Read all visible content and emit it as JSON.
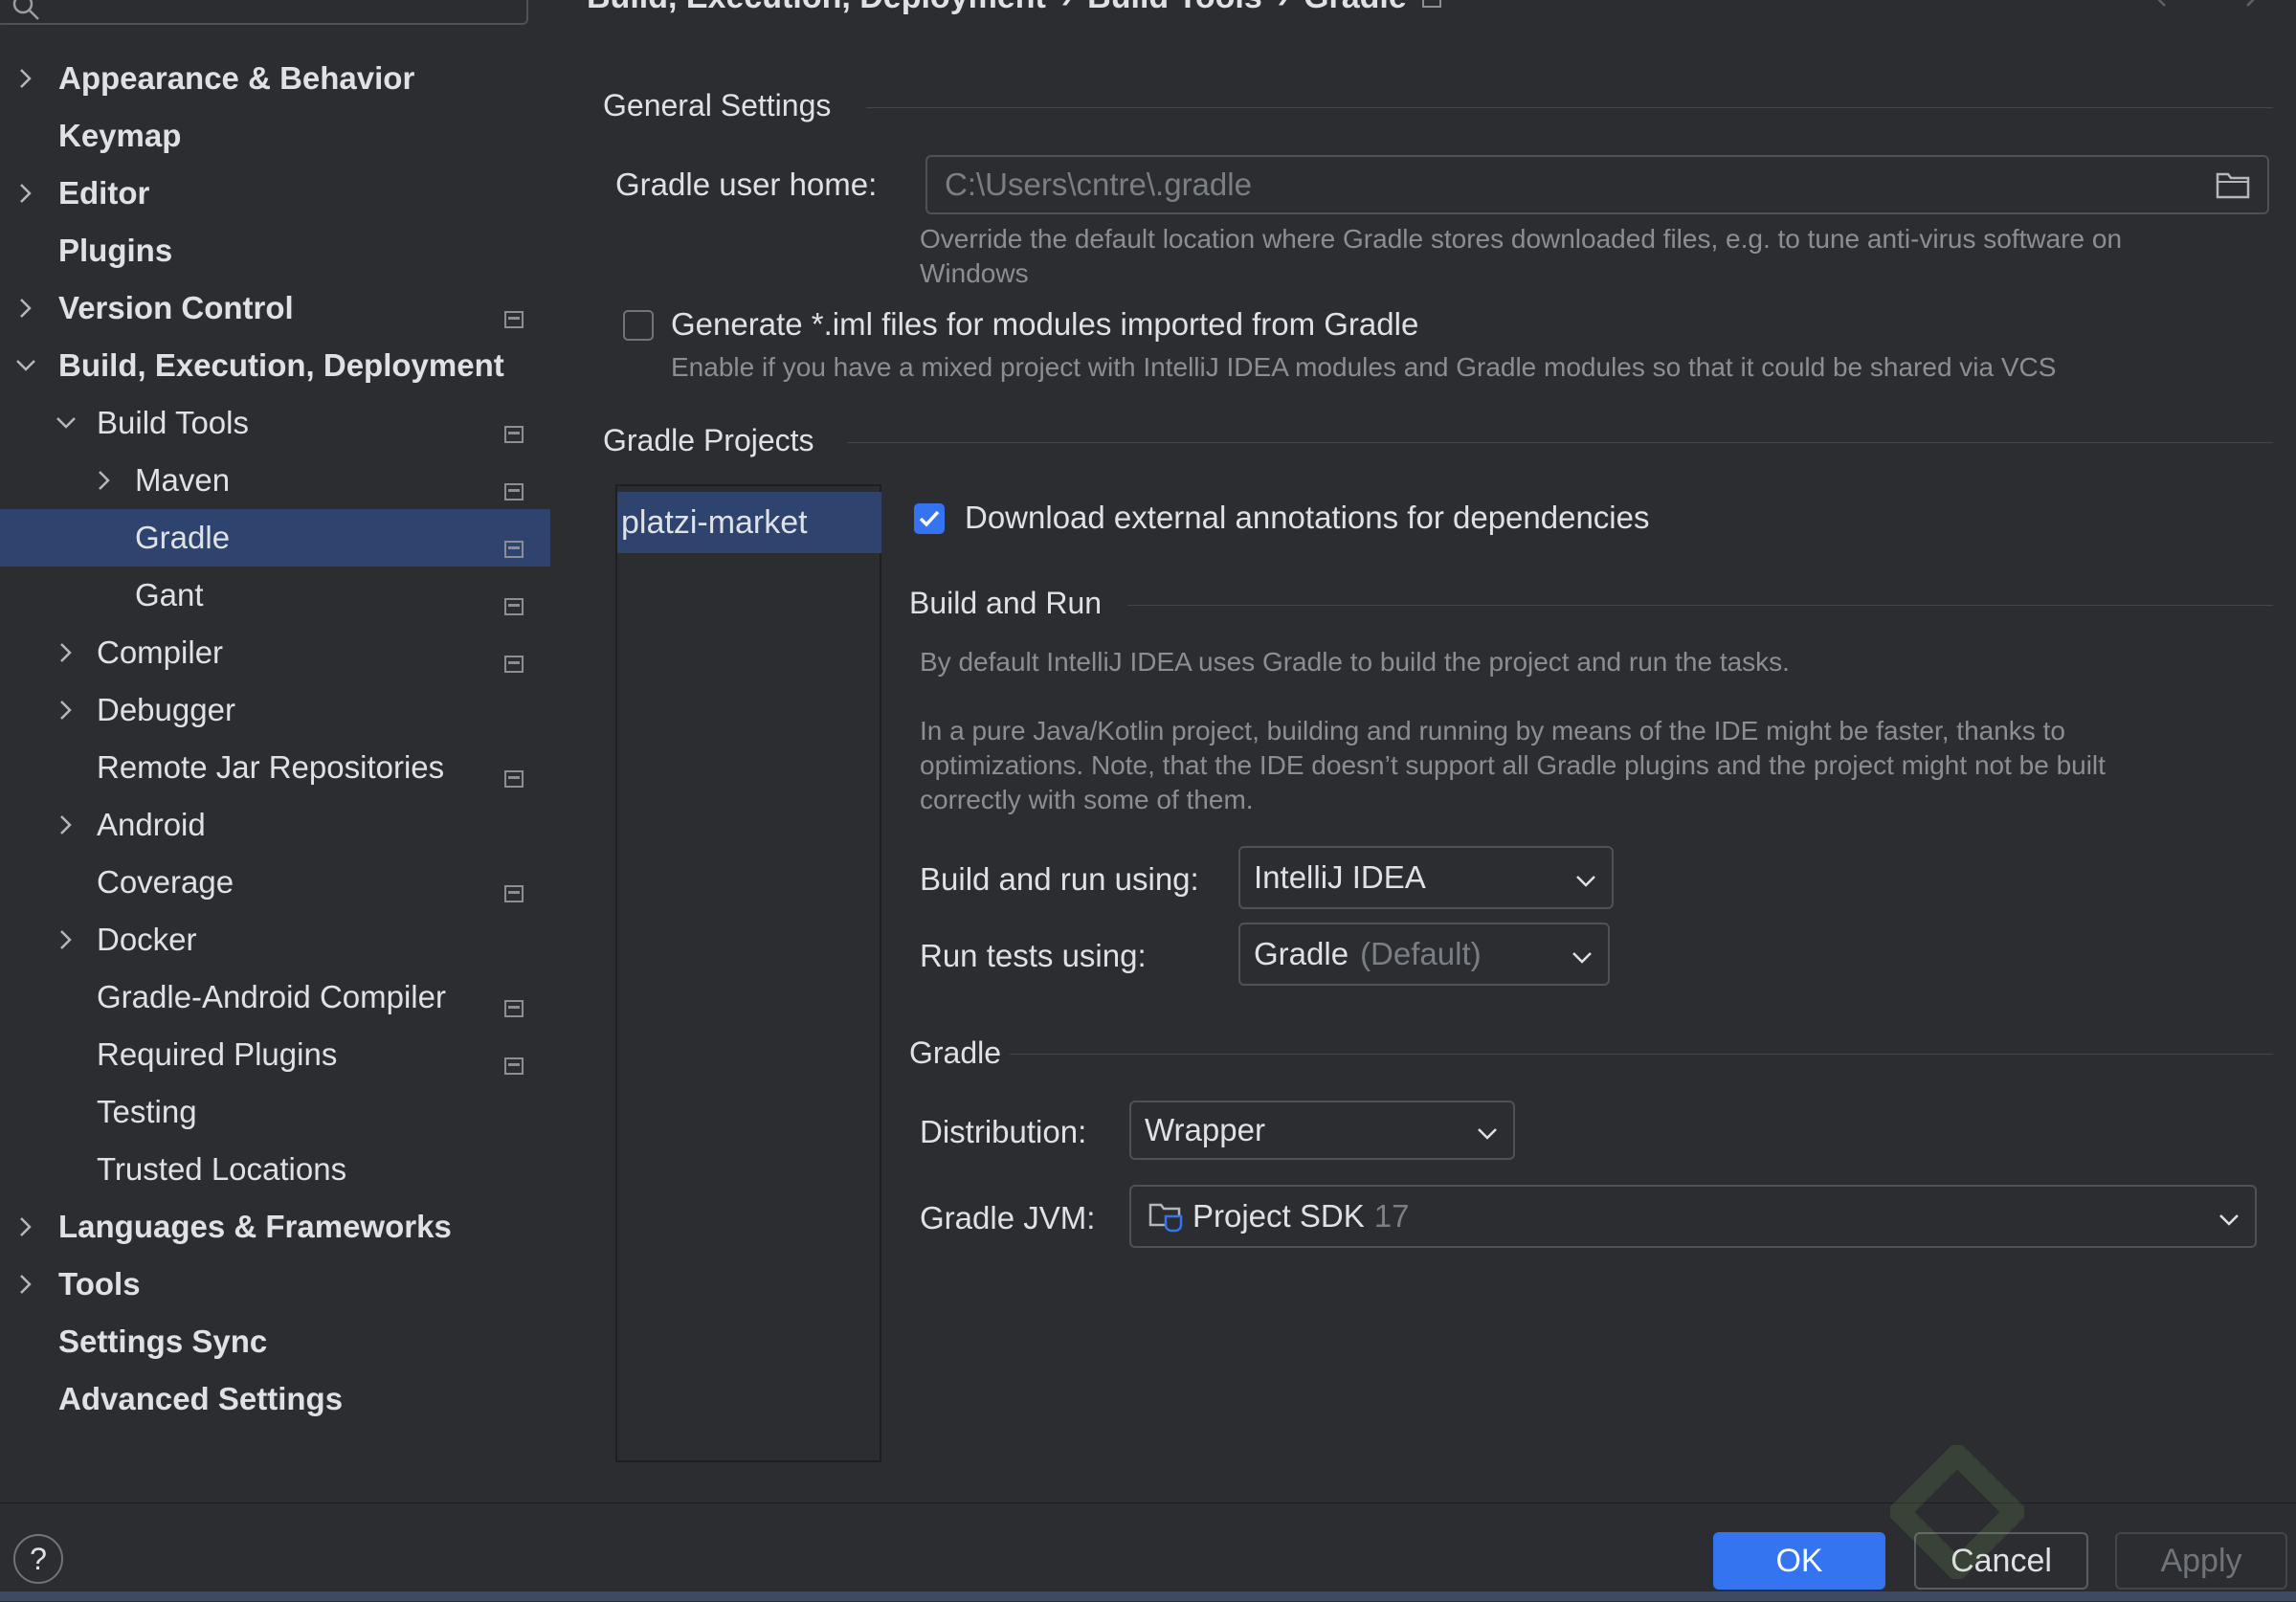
{
  "sidebar": {
    "items": [
      {
        "label": "Appearance & Behavior",
        "expandable": true,
        "expanded": false,
        "level": 0,
        "bold": true,
        "badge": false
      },
      {
        "label": "Keymap",
        "expandable": false,
        "level": 0,
        "bold": true,
        "badge": false
      },
      {
        "label": "Editor",
        "expandable": true,
        "expanded": false,
        "level": 0,
        "bold": true,
        "badge": false
      },
      {
        "label": "Plugins",
        "expandable": false,
        "level": 0,
        "bold": true,
        "badge": false
      },
      {
        "label": "Version Control",
        "expandable": true,
        "expanded": false,
        "level": 0,
        "bold": true,
        "badge": true
      },
      {
        "label": "Build, Execution, Deployment",
        "expandable": true,
        "expanded": true,
        "level": 0,
        "bold": true,
        "badge": false
      },
      {
        "label": "Build Tools",
        "expandable": true,
        "expanded": true,
        "level": 1,
        "bold": false,
        "badge": true
      },
      {
        "label": "Maven",
        "expandable": true,
        "expanded": false,
        "level": 2,
        "bold": false,
        "badge": true
      },
      {
        "label": "Gradle",
        "expandable": false,
        "level": 2,
        "bold": false,
        "badge": true,
        "selected": true
      },
      {
        "label": "Gant",
        "expandable": false,
        "level": 2,
        "bold": false,
        "badge": true
      },
      {
        "label": "Compiler",
        "expandable": true,
        "expanded": false,
        "level": 1,
        "bold": false,
        "badge": true
      },
      {
        "label": "Debugger",
        "expandable": true,
        "expanded": false,
        "level": 1,
        "bold": false,
        "badge": false
      },
      {
        "label": "Remote Jar Repositories",
        "expandable": false,
        "level": 1,
        "bold": false,
        "badge": true
      },
      {
        "label": "Android",
        "expandable": true,
        "expanded": false,
        "level": 1,
        "bold": false,
        "badge": false
      },
      {
        "label": "Coverage",
        "expandable": false,
        "level": 1,
        "bold": false,
        "badge": true
      },
      {
        "label": "Docker",
        "expandable": true,
        "expanded": false,
        "level": 1,
        "bold": false,
        "badge": false
      },
      {
        "label": "Gradle-Android Compiler",
        "expandable": false,
        "level": 1,
        "bold": false,
        "badge": true
      },
      {
        "label": "Required Plugins",
        "expandable": false,
        "level": 1,
        "bold": false,
        "badge": true
      },
      {
        "label": "Testing",
        "expandable": false,
        "level": 1,
        "bold": false,
        "badge": false
      },
      {
        "label": "Trusted Locations",
        "expandable": false,
        "level": 1,
        "bold": false,
        "badge": false
      },
      {
        "label": "Languages & Frameworks",
        "expandable": true,
        "expanded": false,
        "level": 0,
        "bold": true,
        "badge": false
      },
      {
        "label": "Tools",
        "expandable": true,
        "expanded": false,
        "level": 0,
        "bold": true,
        "badge": false
      },
      {
        "label": "Settings Sync",
        "expandable": false,
        "level": 0,
        "bold": true,
        "badge": false
      },
      {
        "label": "Advanced Settings",
        "expandable": false,
        "level": 0,
        "bold": true,
        "badge": false
      }
    ]
  },
  "breadcrumb": {
    "parts": [
      "Build, Execution, Deployment",
      "Build Tools",
      "Gradle"
    ],
    "separator": "›"
  },
  "general": {
    "title": "General Settings",
    "user_home_label": "Gradle user home:",
    "user_home_placeholder": "C:\\Users\\cntre\\.gradle",
    "user_home_hint": "Override the default location where Gradle stores downloaded files, e.g. to tune anti-virus software on",
    "user_home_hint_2": "Windows",
    "iml_label": "Generate *.iml files for modules imported from Gradle",
    "iml_checked": false,
    "iml_hint": "Enable if you have a mixed project with IntelliJ IDEA modules and Gradle modules so that it could be shared via VCS"
  },
  "projects": {
    "title": "Gradle Projects",
    "items": [
      "platzi-market"
    ],
    "download_annotations_label": "Download external annotations for dependencies",
    "download_annotations_checked": true
  },
  "build_and_run": {
    "title": "Build and Run",
    "desc_1": "By default IntelliJ IDEA uses Gradle to build the project and run the tasks.",
    "desc_2_line1": "In a pure Java/Kotlin project, building and running by means of the IDE might be faster, thanks to",
    "desc_2_line2": "optimizations. Note, that the IDE doesn’t support all Gradle plugins and the project might not be built",
    "desc_2_line3": "correctly with some of them.",
    "build_run_label": "Build and run using:",
    "build_run_value": "IntelliJ IDEA",
    "run_tests_label": "Run tests using:",
    "run_tests_value": "Gradle",
    "run_tests_suffix": "(Default)"
  },
  "gradle": {
    "title": "Gradle",
    "distribution_label": "Distribution:",
    "distribution_value": "Wrapper",
    "jvm_label": "Gradle JVM:",
    "jvm_value": "Project SDK",
    "jvm_version": "17"
  },
  "footer": {
    "help": "?",
    "ok": "OK",
    "cancel": "Cancel",
    "apply": "Apply"
  },
  "colors": {
    "background": "#2b2d30",
    "selection": "#2e436e",
    "accent": "#3574f0",
    "text": "#dfe1e5",
    "muted": "#8b8e94"
  }
}
